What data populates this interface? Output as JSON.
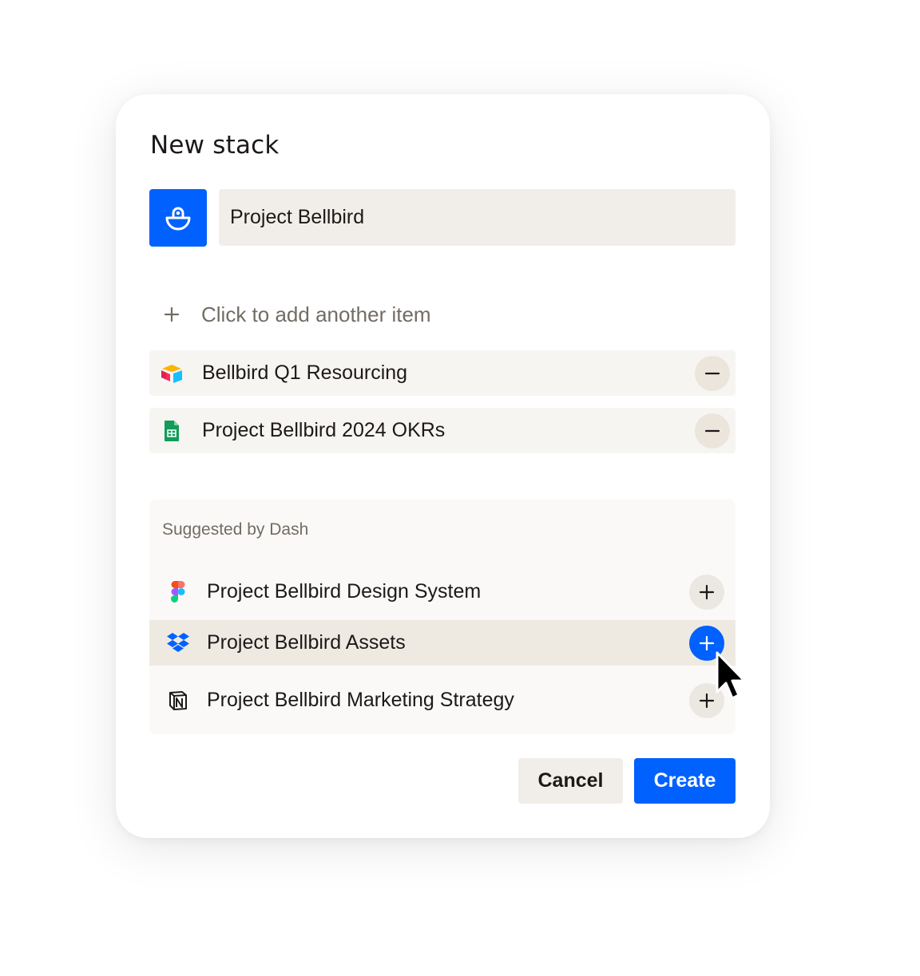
{
  "dialog": {
    "title": "New stack",
    "stack_icon": "bellbird-icon",
    "name_value": "Project Bellbird",
    "add_item_label": "Click to add another item"
  },
  "items": [
    {
      "label": "Bellbird Q1 Resourcing",
      "icon": "airtable-icon",
      "action": "remove"
    },
    {
      "label": "Project Bellbird 2024 OKRs",
      "icon": "google-sheets-icon",
      "action": "remove"
    }
  ],
  "suggestions": {
    "title": "Suggested by Dash",
    "items": [
      {
        "label": "Project Bellbird Design System",
        "icon": "figma-icon",
        "action": "add"
      },
      {
        "label": "Project Bellbird Assets",
        "icon": "dropbox-icon",
        "action": "add",
        "hovered": true
      },
      {
        "label": "Project Bellbird Marketing Strategy",
        "icon": "notion-icon",
        "action": "add"
      }
    ]
  },
  "footer": {
    "cancel_label": "Cancel",
    "create_label": "Create"
  },
  "colors": {
    "accent": "#0061fe",
    "input_bg": "#f1eeea",
    "row_bg": "#f7f5f2"
  }
}
